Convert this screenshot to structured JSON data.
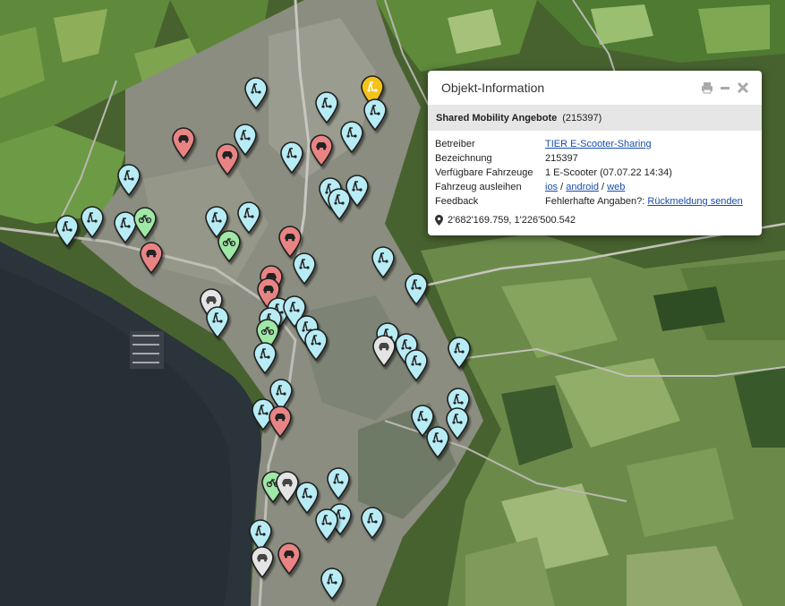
{
  "popup": {
    "title": "Objekt-Information",
    "icons": [
      "print-icon",
      "minimize-icon",
      "close-icon"
    ],
    "subheader": {
      "category": "Shared Mobility Angebote",
      "id": "(215397)"
    },
    "rows": {
      "operator_label": "Betreiber",
      "operator_value": "TIER E-Scooter-Sharing",
      "designation_label": "Bezeichnung",
      "designation_value": "215397",
      "vehicles_label": "Verfügbare Fahrzeuge",
      "vehicles_value": "1 E-Scooter (07.07.22 14:34)",
      "rent_label": "Fahrzeug ausleihen",
      "rent_links": [
        "ios",
        "android",
        "web"
      ],
      "rent_sep": "/",
      "feedback_label": "Feedback",
      "feedback_text": "Fehlerhafte Angaben?:",
      "feedback_link": "Rückmeldung senden"
    },
    "coordinates": "2'682'169.759, 1'226'500.542"
  },
  "legend_colors": {
    "escooter": "#b7ecf5",
    "car": "#e98484",
    "bike": "#9fe8a6",
    "other": "#e4e4e4",
    "selected": "#f5c21a"
  },
  "marker_types": [
    "escooter",
    "car",
    "bike",
    "other",
    "selected"
  ]
}
